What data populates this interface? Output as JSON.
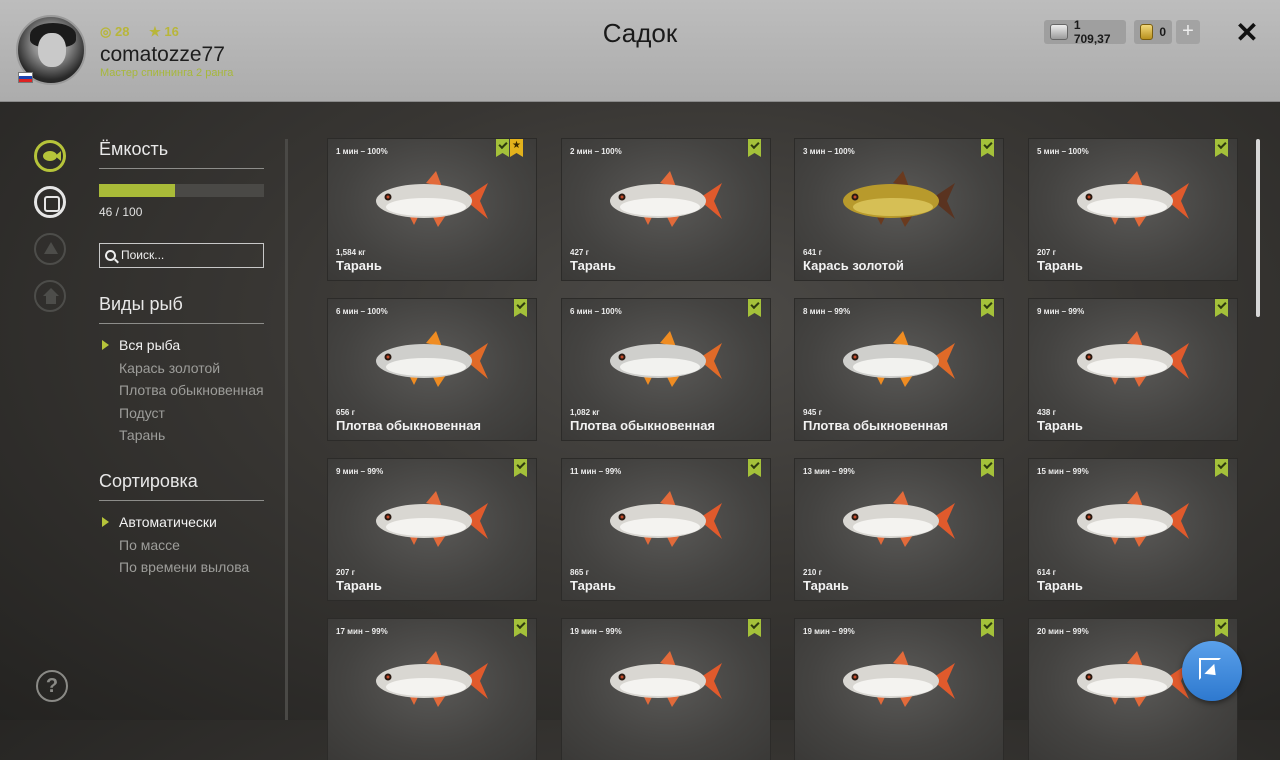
{
  "header": {
    "title": "Садок",
    "username": "comatozze77",
    "rank": "Мастер спиннинга 2 ранга",
    "level": "28",
    "stars": "16",
    "silver": "1 709,37",
    "gold": "0"
  },
  "panel": {
    "capacity_title": "Ёмкость",
    "capacity_text": "46 / 100",
    "capacity_value": 46,
    "capacity_max": 100,
    "search_placeholder": "Поиск...",
    "species_title": "Виды рыб",
    "species": [
      "Вся рыба",
      "Карась золотой",
      "Плотва обыкновенная",
      "Подуст",
      "Тарань"
    ],
    "sort_title": "Сортировка",
    "sort": [
      "Автоматически",
      "По массе",
      "По времени вылова"
    ]
  },
  "colors": {
    "accent": "#a9bb38",
    "gold_badge": "#e3b21c"
  },
  "cards": [
    {
      "time": "1 мин – 100%",
      "weight": "1,584 кг",
      "name": "Тарань",
      "fish": "roach-taran",
      "star": true
    },
    {
      "time": "2 мин – 100%",
      "weight": "427 г",
      "name": "Тарань",
      "fish": "roach-taran",
      "star": false
    },
    {
      "time": "3 мин – 100%",
      "weight": "641 г",
      "name": "Карась золотой",
      "fish": "crucian-gold",
      "star": false
    },
    {
      "time": "5 мин – 100%",
      "weight": "207 г",
      "name": "Тарань",
      "fish": "roach-taran",
      "star": false
    },
    {
      "time": "6 мин – 100%",
      "weight": "656 г",
      "name": "Плотва обыкновенная",
      "fish": "roach",
      "star": false
    },
    {
      "time": "6 мин – 100%",
      "weight": "1,082 кг",
      "name": "Плотва обыкновенная",
      "fish": "roach",
      "star": false
    },
    {
      "time": "8 мин – 99%",
      "weight": "945 г",
      "name": "Плотва обыкновенная",
      "fish": "roach",
      "star": false
    },
    {
      "time": "9 мин – 99%",
      "weight": "438 г",
      "name": "Тарань",
      "fish": "roach-taran",
      "star": false
    },
    {
      "time": "9 мин – 99%",
      "weight": "207 г",
      "name": "Тарань",
      "fish": "roach-taran",
      "star": false
    },
    {
      "time": "11 мин – 99%",
      "weight": "865 г",
      "name": "Тарань",
      "fish": "roach-taran",
      "star": false
    },
    {
      "time": "13 мин – 99%",
      "weight": "210 г",
      "name": "Тарань",
      "fish": "roach-taran",
      "star": false
    },
    {
      "time": "15 мин – 99%",
      "weight": "614 г",
      "name": "Тарань",
      "fish": "roach-taran",
      "star": false
    },
    {
      "time": "17 мин – 99%",
      "weight": "",
      "name": "",
      "fish": "roach-taran",
      "star": false
    },
    {
      "time": "19 мин – 99%",
      "weight": "",
      "name": "",
      "fish": "roach-taran",
      "star": false
    },
    {
      "time": "19 мин – 99%",
      "weight": "",
      "name": "",
      "fish": "roach-taran",
      "star": false
    },
    {
      "time": "20 мин – 99%",
      "weight": "",
      "name": "",
      "fish": "roach-taran",
      "star": false
    }
  ]
}
